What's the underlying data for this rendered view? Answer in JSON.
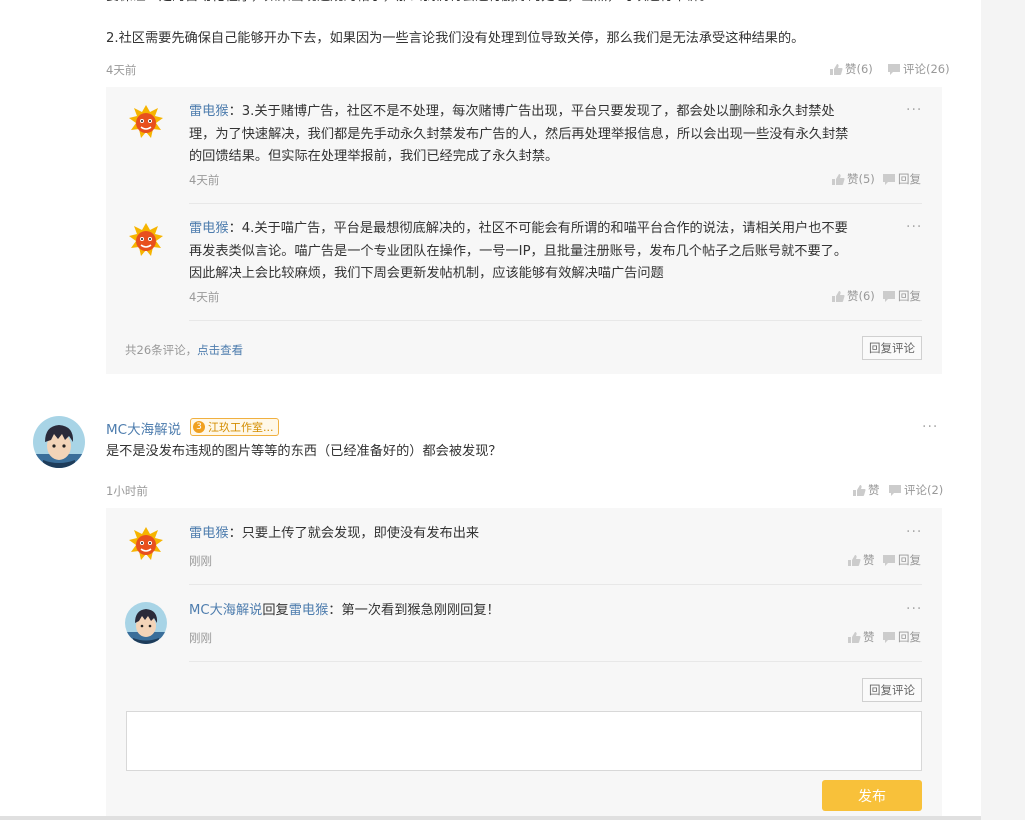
{
  "post": {
    "cut_line": "要保证一定的自动化程序，如果出现违规的帖子，那么我们将会进行删除的处理，当然，可以进行申诉。",
    "para2": "2.社区需要先确保自己能够开办下去，如果因为一些言论我们没有处理到位导致关停，那么我们是无法承受这种结果的。",
    "time": "4天前",
    "like": "赞(6)",
    "comment": "评论(26)"
  },
  "thread1": {
    "replies": [
      {
        "author": "雷电猴",
        "sep": "：",
        "line1": "3.关于赌博广告，社区不是不处理，每次赌博广告出现，平台只要发现了，都会处以删除和永久封禁处",
        "line2": "理，为了快速解决，我们都是先手动永久封禁发布广告的人，然后再处理举报信息，所以会出现一些没有永久封禁",
        "line3": "的回馈结果。但实际在处理举报前，我们已经完成了永久封禁。",
        "time": "4天前",
        "like": "赞(5)",
        "reply": "回复"
      },
      {
        "author": "雷电猴",
        "sep": "：",
        "line1": "4.关于喵广告，平台是最想彻底解决的，社区不可能会有所谓的和喵平台合作的说法，请相关用户也不要",
        "line2": "再发表类似言论。喵广告是一个专业团队在操作，一号一IP，且批量注册账号，发布几个帖子之后账号就不要了。",
        "line3": "因此解决上会比较麻烦，我们下周会更新发帖机制，应该能够有效解决喵广告问题",
        "time": "4天前",
        "like": "赞(6)",
        "reply": "回复"
      }
    ],
    "total_prefix": "共26条评论，",
    "total_link": "点击查看",
    "reply_button": "回复评论"
  },
  "comment2": {
    "author": "MC大海解说",
    "badge_num": "3",
    "badge_text": "江玖工作室...",
    "text": "是不是没发布违规的图片等等的东西（已经准备好的）都会被发现？",
    "time": "1小时前",
    "like": "赞",
    "comment": "评论(2)"
  },
  "thread2": {
    "replies": [
      {
        "author": "雷电猴",
        "sep": "：",
        "text": "只要上传了就会发现，即使没有发布出来",
        "time": "刚刚",
        "like": "赞",
        "reply": "回复"
      },
      {
        "author": "MC大海解说",
        "mid": "回复",
        "target": "雷电猴",
        "sep": "：",
        "text": "第一次看到猴急刚刚回复！",
        "time": "刚刚",
        "like": "赞",
        "reply": "回复"
      }
    ],
    "reply_button": "回复评论",
    "input_placeholder": "",
    "publish": "发布"
  },
  "colors": {
    "link": "#4e7dae",
    "publish": "#f8c13a",
    "badge": "#f0a020"
  }
}
